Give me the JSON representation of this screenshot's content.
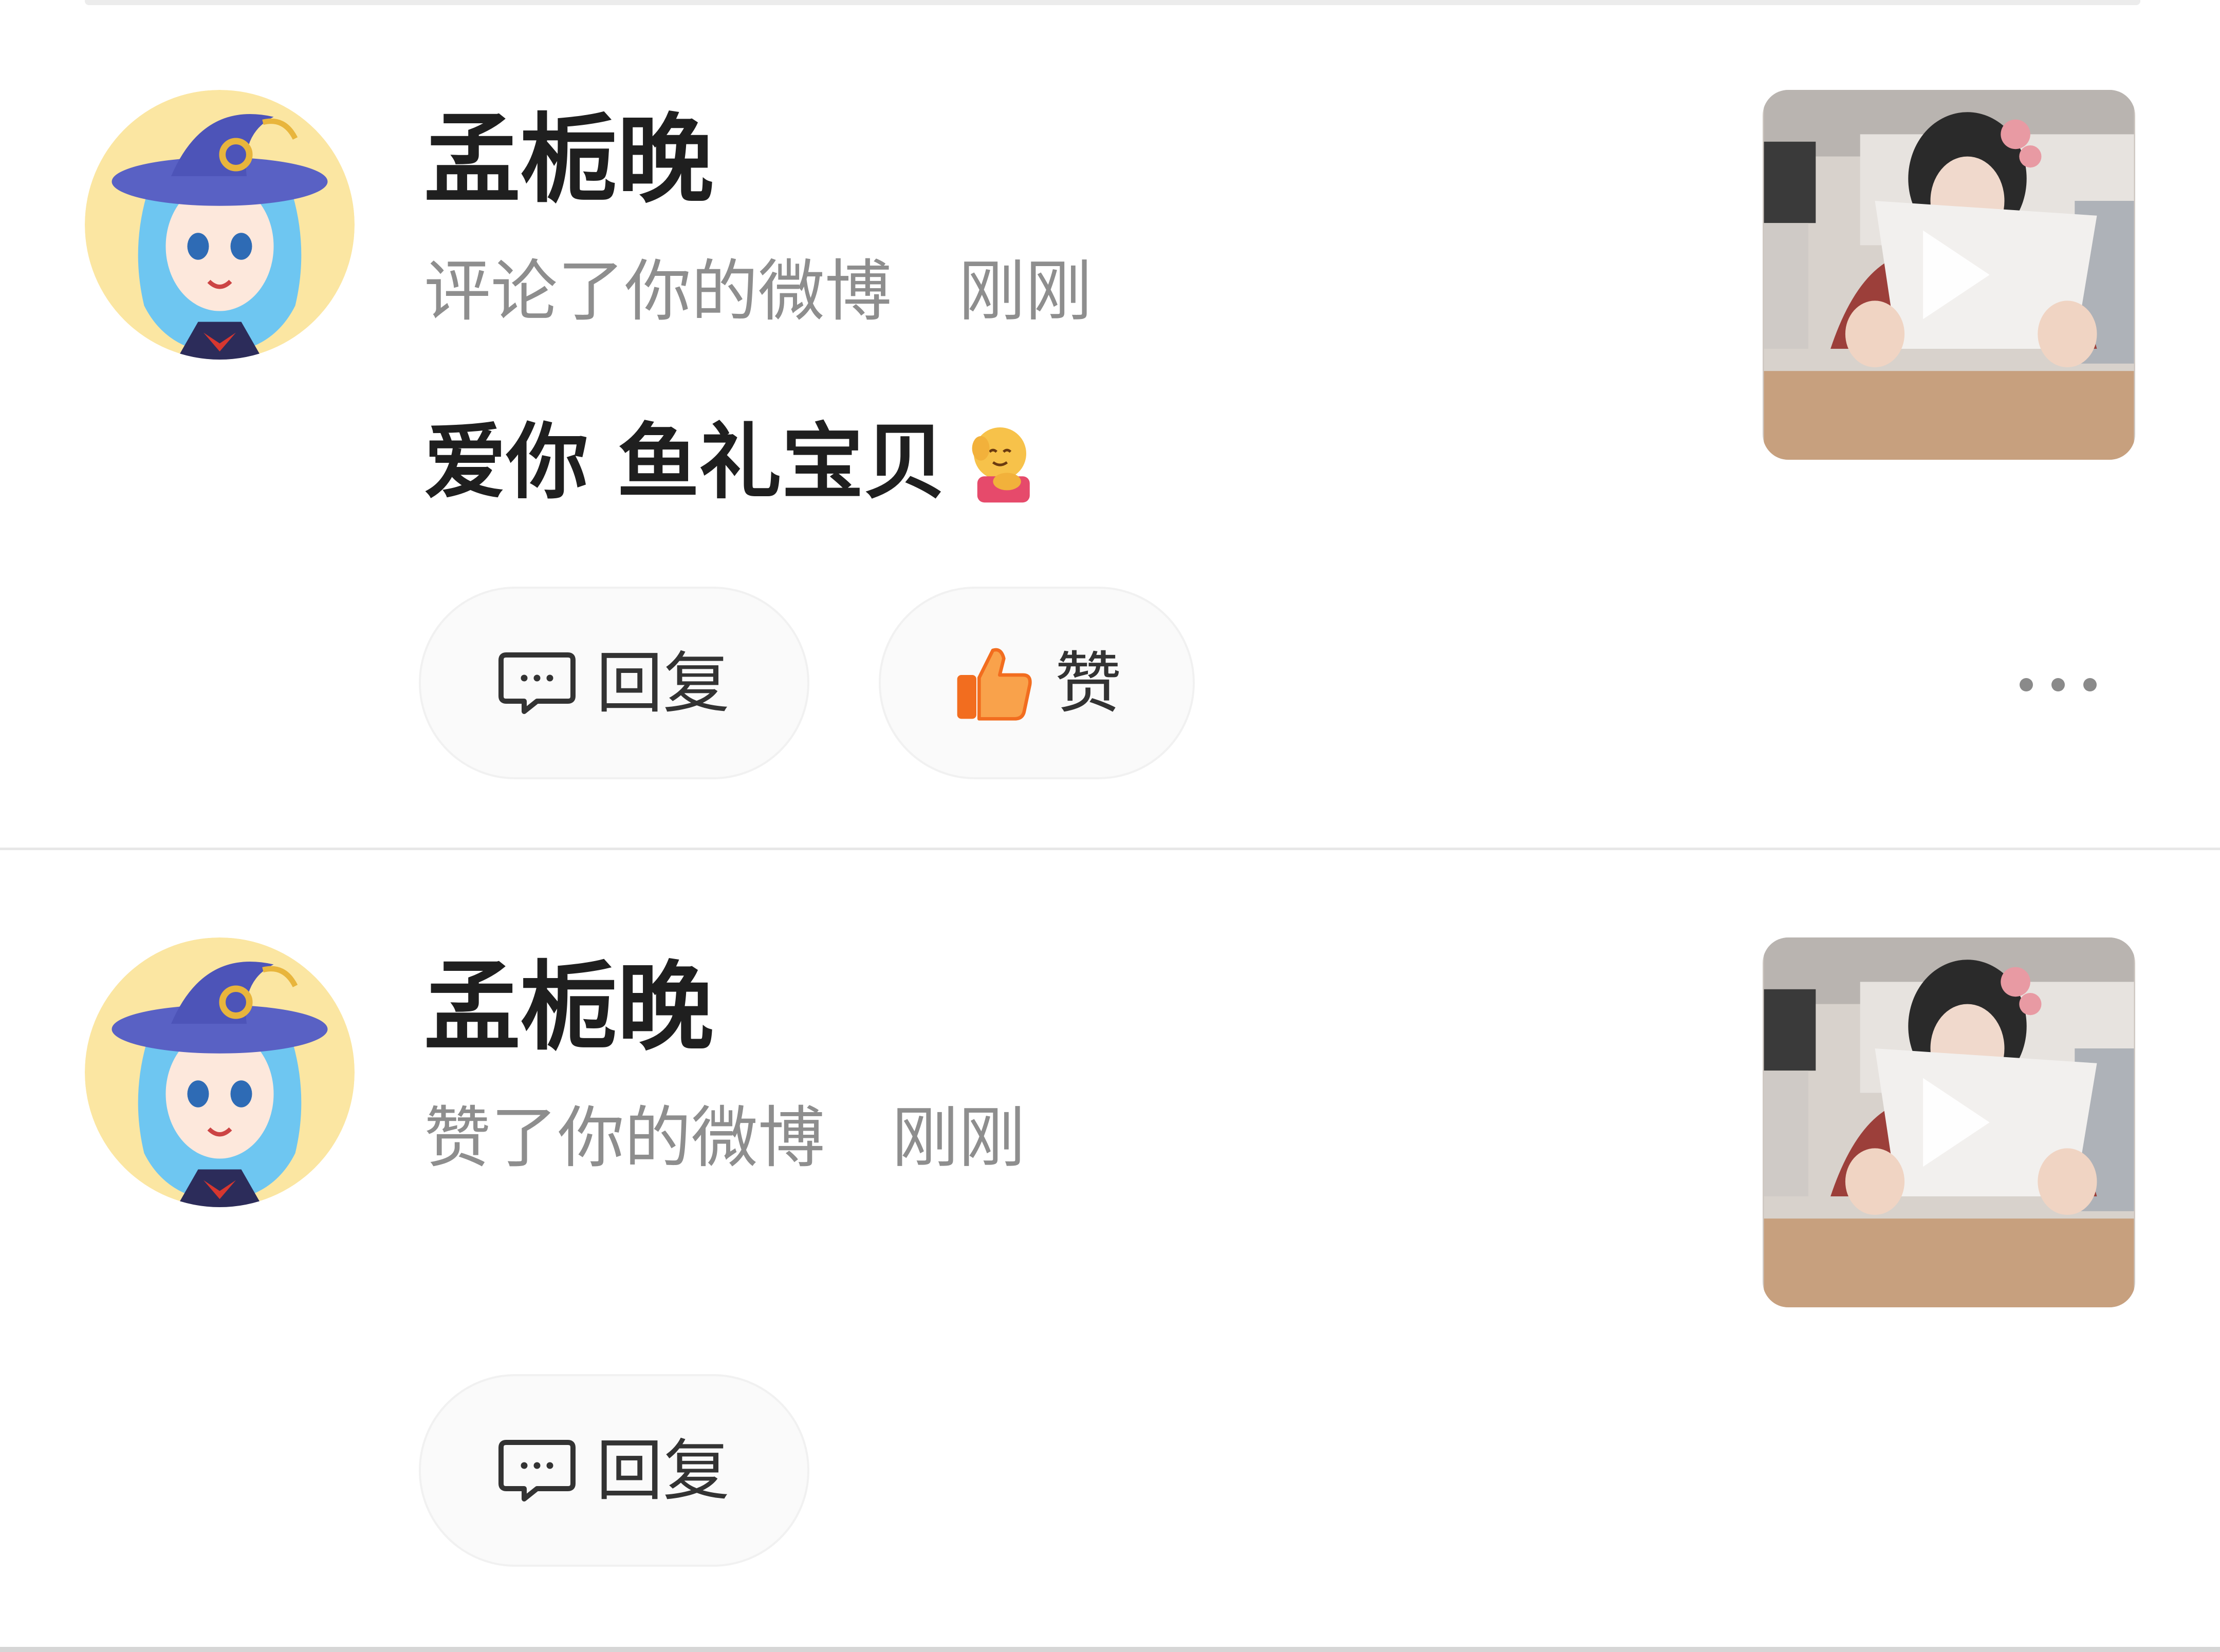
{
  "notifications": [
    {
      "avatar_icon": "anime-witch-avatar",
      "username": "孟栀晚",
      "action": "评论了你的微博",
      "time": "刚刚",
      "comment": "爱你 鱼礼宝贝",
      "comment_emoji": "hug-emoji",
      "thumbnail_icon": "video-play-icon",
      "reply_label": "回复",
      "like_label": "赞",
      "more_icon": "more-icon"
    },
    {
      "avatar_icon": "anime-witch-avatar",
      "username": "孟栀晚",
      "action": "赞了你的微博",
      "time": "刚刚",
      "thumbnail_icon": "video-play-icon",
      "reply_label": "回复"
    }
  ],
  "colors": {
    "text_primary": "#1f1f1f",
    "text_secondary": "#8e8e8e",
    "like_orange": "#f26d1f",
    "pill_background": "#fafafa"
  }
}
